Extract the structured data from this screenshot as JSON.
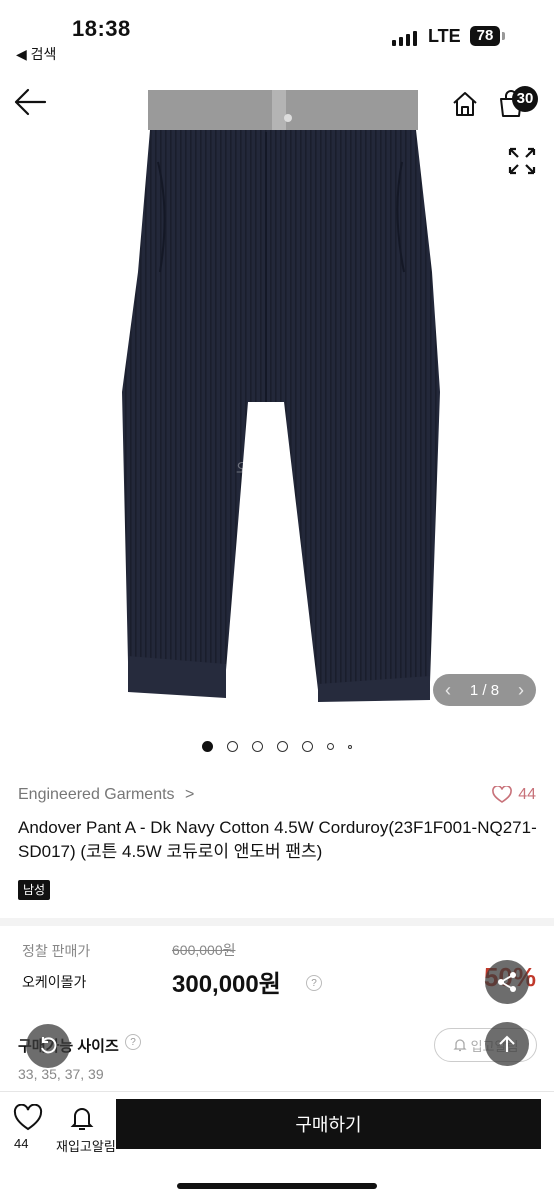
{
  "status_bar": {
    "time": "18:38",
    "back_app": "◀ 검색",
    "network": "LTE",
    "battery": "78"
  },
  "header": {
    "cart_count": "30"
  },
  "gallery": {
    "watermark": "오케이몰",
    "pager": "1 / 8",
    "pager_prev": "‹",
    "pager_next": "›"
  },
  "product": {
    "brand": "Engineered Garments",
    "brand_chevron": ">",
    "likes": "44",
    "title": "Andover Pant A - Dk Navy Cotton 4.5W Corduroy(23F1F001-NQ271-SD017) (코튼 4.5W 코듀로이 앤도버 팬츠)",
    "tag": "남성"
  },
  "pricing": {
    "retail_label": "정찰 판매가",
    "retail_price": "600,000원",
    "sale_label": "오케이몰가",
    "sale_price": "300,000원",
    "discount": "50%",
    "help": "?"
  },
  "sizes": {
    "title": "구매가능 사이즈",
    "values": "33, 35, 37, 39",
    "restock_label": "입고알림",
    "help": "?"
  },
  "bottom_bar": {
    "like_count": "44",
    "restock_alert": "재입고알림",
    "buy_label": "구매하기"
  },
  "colors": {
    "pant_navy": "#23283a",
    "waistband_gray": "#9a9a9a",
    "like_red": "#c8727a",
    "discount_red": "#c0392b"
  }
}
